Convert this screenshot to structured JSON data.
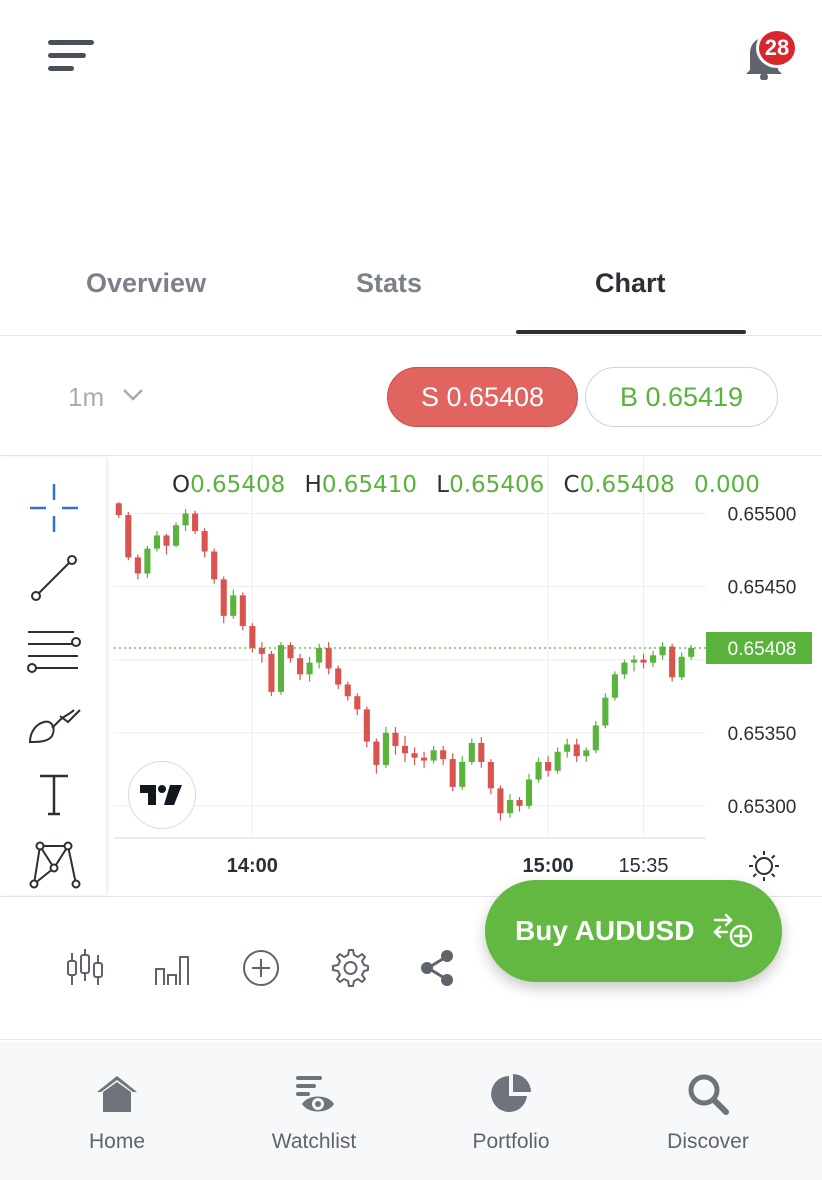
{
  "header": {
    "notifications_count": "28"
  },
  "tabs": [
    {
      "label": "Overview",
      "active": false
    },
    {
      "label": "Stats",
      "active": false
    },
    {
      "label": "Chart",
      "active": true
    }
  ],
  "controls": {
    "interval": "1m",
    "sell_label": "S 0.65408",
    "buy_label": "B 0.65419"
  },
  "ohlc": {
    "o_label": "O",
    "o_value": "0.65408",
    "h_label": "H",
    "h_value": "0.65410",
    "l_label": "L",
    "l_value": "0.65406",
    "c_label": "C",
    "c_value": "0.65408",
    "change": "0.000"
  },
  "drawing_tools": [
    "crosshair-icon",
    "trend-line-icon",
    "fib-retracement-icon",
    "brush-icon",
    "text-tool-icon",
    "pattern-icon"
  ],
  "chart_data": {
    "type": "candlestick",
    "ylim": [
      0.65278,
      0.65512
    ],
    "y_ticks": [
      "0.65500",
      "0.65450",
      "0.65350",
      "0.65300"
    ],
    "x_ticks": [
      {
        "label": "14:00",
        "bold": true
      },
      {
        "label": "15:00",
        "bold": true
      },
      {
        "label": "15:35",
        "bold": false
      }
    ],
    "last_price_label": "0.65408",
    "last_price": 0.65408,
    "colors": {
      "up": "#59b33c",
      "down": "#d9534f",
      "grid": "#ebedf0"
    },
    "candles": [
      [
        0.65507,
        0.65508,
        0.65497,
        0.65499
      ],
      [
        0.65499,
        0.65501,
        0.65468,
        0.6547
      ],
      [
        0.6547,
        0.65472,
        0.65455,
        0.65459
      ],
      [
        0.65459,
        0.65478,
        0.65456,
        0.65476
      ],
      [
        0.65476,
        0.65488,
        0.65474,
        0.65485
      ],
      [
        0.65485,
        0.65486,
        0.65472,
        0.65478
      ],
      [
        0.65478,
        0.65494,
        0.65477,
        0.65492
      ],
      [
        0.65492,
        0.65503,
        0.65488,
        0.655
      ],
      [
        0.655,
        0.65502,
        0.65486,
        0.65488
      ],
      [
        0.65488,
        0.6549,
        0.6547,
        0.65474
      ],
      [
        0.65474,
        0.65476,
        0.65452,
        0.65455
      ],
      [
        0.65455,
        0.65457,
        0.65425,
        0.6543
      ],
      [
        0.6543,
        0.65448,
        0.65428,
        0.65444
      ],
      [
        0.65444,
        0.65446,
        0.6542,
        0.65423
      ],
      [
        0.65423,
        0.65425,
        0.65405,
        0.65408
      ],
      [
        0.65408,
        0.65412,
        0.65398,
        0.65404
      ],
      [
        0.65404,
        0.65406,
        0.65375,
        0.65378
      ],
      [
        0.65378,
        0.65412,
        0.65376,
        0.6541
      ],
      [
        0.6541,
        0.65412,
        0.65398,
        0.65401
      ],
      [
        0.65401,
        0.65404,
        0.65386,
        0.6539
      ],
      [
        0.6539,
        0.65402,
        0.65385,
        0.65398
      ],
      [
        0.65398,
        0.65411,
        0.65394,
        0.65408
      ],
      [
        0.65408,
        0.65412,
        0.6539,
        0.65394
      ],
      [
        0.65394,
        0.65396,
        0.6538,
        0.65383
      ],
      [
        0.65383,
        0.65385,
        0.65372,
        0.65375
      ],
      [
        0.65375,
        0.65377,
        0.65362,
        0.65366
      ],
      [
        0.65366,
        0.65368,
        0.6534,
        0.65344
      ],
      [
        0.65344,
        0.65346,
        0.65322,
        0.65328
      ],
      [
        0.65328,
        0.65354,
        0.65326,
        0.6535
      ],
      [
        0.6535,
        0.65354,
        0.65335,
        0.65341
      ],
      [
        0.65341,
        0.65348,
        0.6533,
        0.65336
      ],
      [
        0.65336,
        0.6534,
        0.65328,
        0.65333
      ],
      [
        0.65333,
        0.65337,
        0.65326,
        0.65331
      ],
      [
        0.65331,
        0.65341,
        0.65329,
        0.65338
      ],
      [
        0.65338,
        0.65341,
        0.65328,
        0.65332
      ],
      [
        0.65332,
        0.65336,
        0.6531,
        0.65313
      ],
      [
        0.65313,
        0.65334,
        0.65311,
        0.6533
      ],
      [
        0.6533,
        0.65346,
        0.65328,
        0.65343
      ],
      [
        0.65343,
        0.65347,
        0.65326,
        0.6533
      ],
      [
        0.6533,
        0.65332,
        0.65308,
        0.65312
      ],
      [
        0.65312,
        0.65314,
        0.6529,
        0.65295
      ],
      [
        0.65295,
        0.65308,
        0.65292,
        0.65304
      ],
      [
        0.65304,
        0.65306,
        0.65296,
        0.653
      ],
      [
        0.653,
        0.65322,
        0.65298,
        0.65318
      ],
      [
        0.65318,
        0.65333,
        0.65316,
        0.6533
      ],
      [
        0.6533,
        0.65334,
        0.6532,
        0.65324
      ],
      [
        0.65324,
        0.6534,
        0.65322,
        0.65337
      ],
      [
        0.65337,
        0.65346,
        0.65333,
        0.65342
      ],
      [
        0.65342,
        0.65346,
        0.6533,
        0.65334
      ],
      [
        0.65334,
        0.6534,
        0.6533,
        0.65338
      ],
      [
        0.65338,
        0.65358,
        0.65336,
        0.65355
      ],
      [
        0.65355,
        0.65377,
        0.65353,
        0.65374
      ],
      [
        0.65374,
        0.65392,
        0.65372,
        0.6539
      ],
      [
        0.6539,
        0.654,
        0.65387,
        0.65398
      ],
      [
        0.65398,
        0.65403,
        0.65392,
        0.654
      ],
      [
        0.654,
        0.65404,
        0.65394,
        0.65398
      ],
      [
        0.65398,
        0.65406,
        0.65395,
        0.65403
      ],
      [
        0.65403,
        0.65412,
        0.654,
        0.65409
      ],
      [
        0.65409,
        0.65411,
        0.65385,
        0.65388
      ],
      [
        0.65388,
        0.65405,
        0.65386,
        0.65402
      ],
      [
        0.65402,
        0.6541,
        0.654,
        0.65408
      ]
    ]
  },
  "bottom_toolbar": [
    "candles-icon",
    "bars-icon",
    "add-indicator-icon",
    "settings-icon",
    "share-icon"
  ],
  "buy_fab": {
    "label": "Buy AUDUSD"
  },
  "nav": [
    {
      "label": "Home",
      "icon": "home-icon"
    },
    {
      "label": "Watchlist",
      "icon": "watchlist-icon"
    },
    {
      "label": "Portfolio",
      "icon": "portfolio-icon"
    },
    {
      "label": "Discover",
      "icon": "discover-icon"
    }
  ]
}
